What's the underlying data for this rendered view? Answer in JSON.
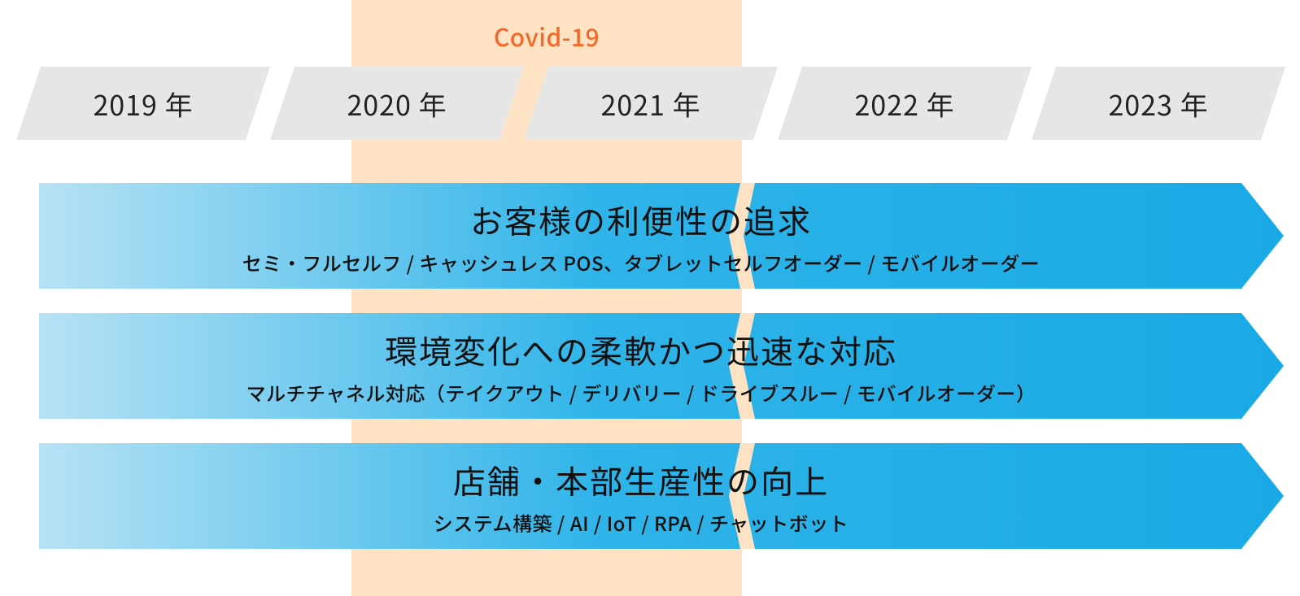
{
  "covid": {
    "label": "Covid-19"
  },
  "years": [
    "2019 年",
    "2020 年",
    "2021 年",
    "2022 年",
    "2023 年"
  ],
  "arrows": [
    {
      "title": "お客様の利便性の追求",
      "sub": "セミ・フルセルフ / キャッシュレス POS、タブレットセルフオーダー / モバイルオーダー"
    },
    {
      "title": "環境変化への柔軟かつ迅速な対応",
      "sub": "マルチチャネル対応（テイクアウト / デリバリー / ドライブスルー / モバイルオーダー）"
    },
    {
      "title": "店舗・本部生産性の向上",
      "sub": "システム構築 / AI / IoT / RPA / チャットボット"
    }
  ],
  "colors": {
    "covid_band": "#fde3c3",
    "covid_text": "#f26a2a",
    "year_fill": "#e6e6e6",
    "arrow_light": "#b7e2f4",
    "arrow_dark": "#19a9e5"
  }
}
